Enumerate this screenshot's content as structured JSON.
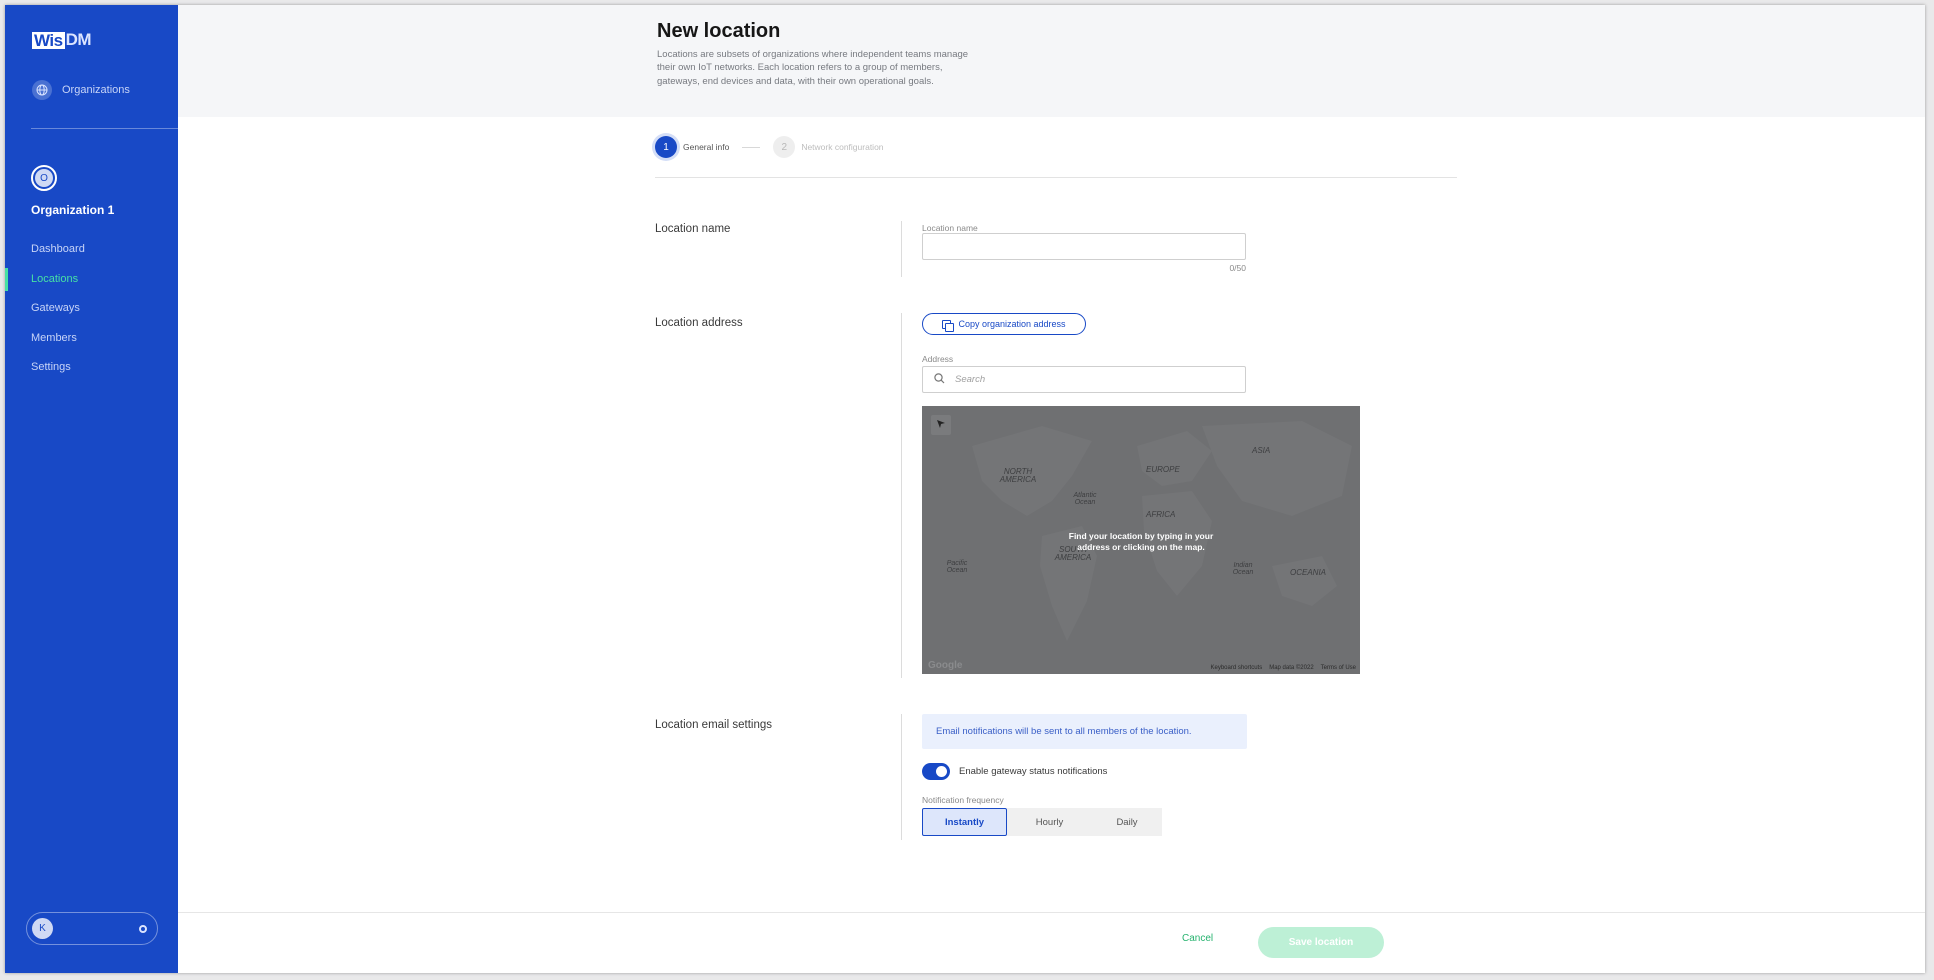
{
  "brand": {
    "logo_part1": "Wis",
    "logo_part2": "DM"
  },
  "sidebar": {
    "org_link_label": "Organizations",
    "org_initial": "O",
    "org_name": "Organization 1",
    "items": [
      {
        "label": "Dashboard",
        "active": false
      },
      {
        "label": "Locations",
        "active": true
      },
      {
        "label": "Gateways",
        "active": false
      },
      {
        "label": "Members",
        "active": false
      },
      {
        "label": "Settings",
        "active": false
      }
    ],
    "user_initial": "K"
  },
  "header": {
    "title": "New location",
    "description": "Locations are subsets of organizations where independent teams manage their own IoT networks. Each location refers to a group of members, gateways, end devices and data, with their own operational goals."
  },
  "stepper": {
    "steps": [
      {
        "number": "1",
        "label": "General info",
        "active": true
      },
      {
        "number": "2",
        "label": "Network configuration",
        "active": false
      }
    ]
  },
  "form": {
    "location_name": {
      "section_label": "Location name",
      "field_label": "Location name",
      "value": "",
      "counter": "0/50"
    },
    "location_address": {
      "section_label": "Location address",
      "copy_button_label": "Copy organization address",
      "field_label": "Address",
      "placeholder": "Search"
    },
    "map": {
      "message": "Find your location by typing in your address or clicking on the map.",
      "labels": {
        "north_america": "NORTH AMERICA",
        "europe": "EUROPE",
        "asia": "ASIA",
        "atlantic": "Atlantic Ocean",
        "africa": "AFRICA",
        "south_america": "SOUTH AMERICA",
        "pacific": "Pacific Ocean",
        "indian": "Indian Ocean",
        "oceania": "OCEANIA"
      },
      "google": "Google",
      "footer": {
        "shortcuts": "Keyboard shortcuts",
        "map_data": "Map data ©2022",
        "terms": "Terms of Use"
      }
    },
    "email_settings": {
      "section_label": "Location email settings",
      "info": "Email notifications will be sent to all members of the location.",
      "toggle_label": "Enable gateway status notifications",
      "toggle_on": true,
      "frequency_label": "Notification frequency",
      "frequency_options": [
        "Instantly",
        "Hourly",
        "Daily"
      ],
      "frequency_selected": "Instantly"
    }
  },
  "footer": {
    "cancel_label": "Cancel",
    "save_label": "Save location"
  },
  "colors": {
    "sidebar": "#1849c6",
    "accent": "#1849c6",
    "active_nav": "#46e0a4",
    "save_disabled": "#bdf0d6"
  }
}
